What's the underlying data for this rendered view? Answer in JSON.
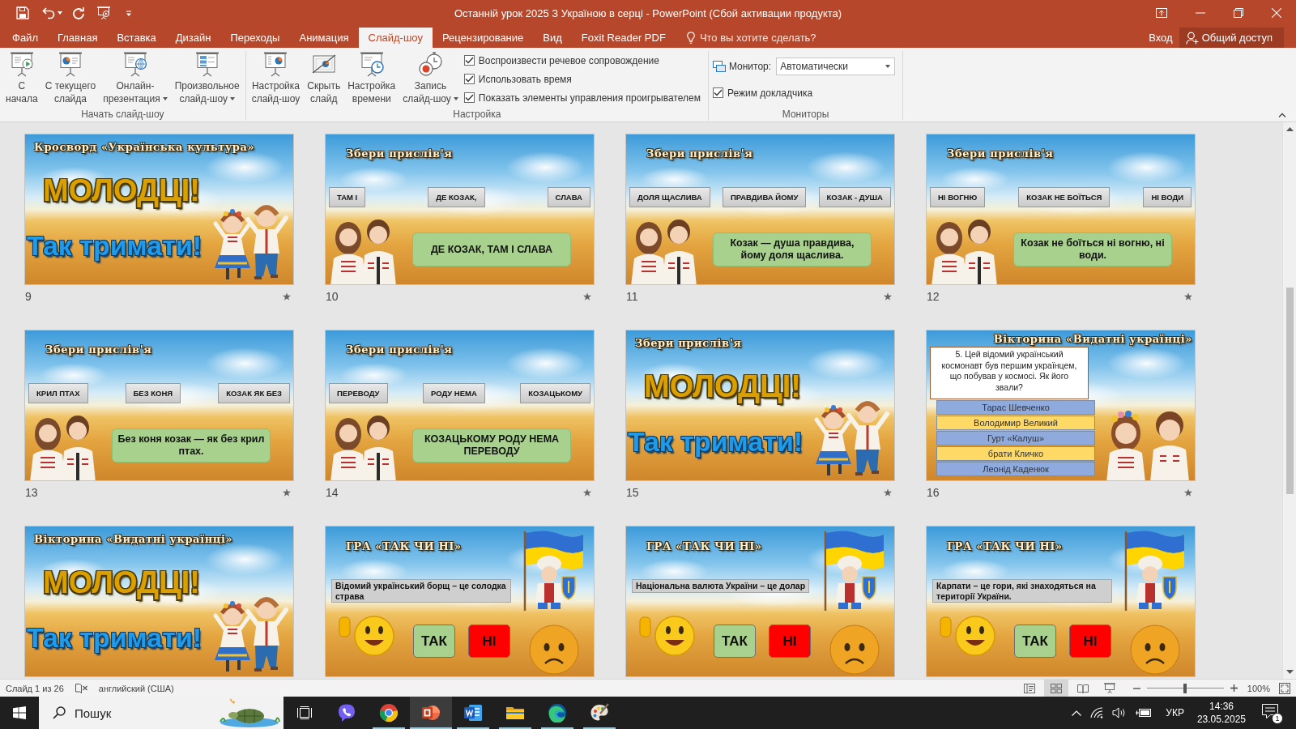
{
  "window": {
    "title": "Останній урок 2025 З Україною в серці - PowerPoint (Сбой активации продукта)"
  },
  "tabs": [
    {
      "label": "Файл",
      "selected": false
    },
    {
      "label": "Главная",
      "selected": false
    },
    {
      "label": "Вставка",
      "selected": false
    },
    {
      "label": "Дизайн",
      "selected": false
    },
    {
      "label": "Переходы",
      "selected": false
    },
    {
      "label": "Анимация",
      "selected": false
    },
    {
      "label": "Слайд-шоу",
      "selected": true
    },
    {
      "label": "Рецензирование",
      "selected": false
    },
    {
      "label": "Вид",
      "selected": false
    },
    {
      "label": "Foxit Reader PDF",
      "selected": false
    }
  ],
  "tell_me": {
    "placeholder": "Что вы хотите сделать?"
  },
  "account": {
    "sign_in": "Вход",
    "share": "Общий доступ"
  },
  "ribbon": {
    "groups": [
      {
        "label": "Начать слайд-шоу",
        "buttons": [
          {
            "kind": "from_start",
            "lines": [
              "С",
              "начала"
            ],
            "dropdown": false
          },
          {
            "kind": "from_current",
            "lines": [
              "С текущего",
              "слайда"
            ],
            "dropdown": false
          },
          {
            "kind": "online",
            "lines": [
              "Онлайн-",
              "презентация"
            ],
            "dropdown": true
          },
          {
            "kind": "custom",
            "lines": [
              "Произвольное",
              "слайд-шоу"
            ],
            "dropdown": true
          }
        ]
      },
      {
        "label": "Настройка",
        "buttons": [
          {
            "kind": "setup",
            "lines": [
              "Настройка",
              "слайд-шоу"
            ],
            "dropdown": false
          },
          {
            "kind": "hide",
            "lines": [
              "Скрыть",
              "слайд"
            ],
            "dropdown": false
          },
          {
            "kind": "timings",
            "lines": [
              "Настройка",
              "времени"
            ],
            "dropdown": false
          },
          {
            "kind": "record",
            "lines": [
              "Запись",
              "слайд-шоу"
            ],
            "dropdown": true
          }
        ],
        "checkboxes": [
          {
            "label": "Воспроизвести речевое сопровождение",
            "checked": true
          },
          {
            "label": "Использовать время",
            "checked": true
          },
          {
            "label": "Показать элементы управления проигрывателем",
            "checked": true
          }
        ]
      },
      {
        "label": "Мониторы",
        "monitor": {
          "label": "Монитор:",
          "value": "Автоматически"
        },
        "checkboxes": [
          {
            "label": "Режим докладчика",
            "checked": true
          }
        ]
      }
    ]
  },
  "slides": [
    {
      "number": "9",
      "animated": true,
      "kind": "celebration",
      "title": "Кросворд «Українська культура»",
      "cheer": "МОЛОДЦІ!",
      "motto": "Так тримати!"
    },
    {
      "number": "10",
      "animated": true,
      "kind": "proverb",
      "title": "Збери прислів'я",
      "tiles": [
        "ТАМ І",
        "ДЕ КОЗАК,",
        "СЛАВА"
      ],
      "answer": "ДЕ КОЗАК, ТАМ І СЛАВА"
    },
    {
      "number": "11",
      "animated": true,
      "kind": "proverb",
      "title": "Збери прислів'я",
      "tiles": [
        "ДОЛЯ ЩАСЛИВА",
        "ПРАВДИВА ЙОМУ",
        "КОЗАК - ДУША"
      ],
      "answer": "Козак — душа правдива, йому доля щаслива."
    },
    {
      "number": "12",
      "animated": true,
      "kind": "proverb",
      "title": "Збери прислів'я",
      "tiles": [
        "НІ ВОГНЮ",
        "КОЗАК НЕ БОЇТЬСЯ",
        "НІ ВОДИ"
      ],
      "answer": "Козак не боїться ні вогню, ні води."
    },
    {
      "number": "13",
      "animated": true,
      "kind": "proverb",
      "title": "Збери прислів'я",
      "tiles": [
        "КРИЛ ПТАХ",
        "БЕЗ КОНЯ",
        "КОЗАК ЯК БЕЗ"
      ],
      "answer": "Без коня козак — як без крил птах."
    },
    {
      "number": "14",
      "animated": true,
      "kind": "proverb",
      "title": "Збери прислів'я",
      "tiles": [
        "ПЕРЕВОДУ",
        "РОДУ НЕМА",
        "КОЗАЦЬКОМУ"
      ],
      "answer": "КОЗАЦЬКОМУ РОДУ НЕМА ПЕРЕВОДУ"
    },
    {
      "number": "15",
      "animated": true,
      "kind": "celebration",
      "title": "Збери прислів'я",
      "cheer": "МОЛОДЦІ!",
      "motto": "Так тримати!"
    },
    {
      "number": "16",
      "animated": true,
      "kind": "quiz",
      "title": "Вікторина «Видатні українці»",
      "question": "5. Цей відомий український космонавт був першим українцем, що побував у космосі. Як його звали?",
      "options": [
        {
          "label": "Тарас Шевченко",
          "color": "#8faadc"
        },
        {
          "label": "Володимир Великий",
          "color": "#ffd966"
        },
        {
          "label": "Гурт «Калуш»",
          "color": "#8faadc"
        },
        {
          "label": "брати Кличко",
          "color": "#ffd966"
        },
        {
          "label": "Леонід Каденюк",
          "color": "#8faadc"
        }
      ]
    },
    {
      "kind": "celebration",
      "title": "Вікторина «Видатні українці»",
      "cheer": "МОЛОДЦІ!",
      "motto": "Так тримати!"
    },
    {
      "kind": "yes_no",
      "title": "ГРА «ТАК ЧИ НІ»",
      "statement": "Відомий український борщ – це солодка страва",
      "yes": "ТАК",
      "no": "НІ"
    },
    {
      "kind": "yes_no",
      "title": "ГРА «ТАК ЧИ НІ»",
      "statement": "Національна валюта України – це долар",
      "yes": "ТАК",
      "no": "НІ"
    },
    {
      "kind": "yes_no",
      "title": "ГРА «ТАК ЧИ НІ»",
      "statement": "Карпати – це гори, які знаходяться на території України.",
      "yes": "ТАК",
      "no": "НІ"
    }
  ],
  "status_bar": {
    "slide_info": "Слайд 1 из 26",
    "language": "английский (США)",
    "views": [
      {
        "kind": "normal",
        "selected": false
      },
      {
        "kind": "sorter",
        "selected": true
      },
      {
        "kind": "reading",
        "selected": false
      },
      {
        "kind": "slideshow",
        "selected": false
      }
    ],
    "zoom": {
      "level": 0.5,
      "reading": "100%"
    }
  },
  "taskbar": {
    "search": {
      "placeholder": "Пошук"
    },
    "apps": [
      {
        "kind": "viber",
        "selected": false,
        "running": false
      },
      {
        "kind": "chrome",
        "selected": false,
        "running": true
      },
      {
        "kind": "powerpoint",
        "selected": true,
        "running": true
      },
      {
        "kind": "word",
        "selected": false,
        "running": true
      },
      {
        "kind": "explorer",
        "selected": false,
        "running": true
      },
      {
        "kind": "edge",
        "selected": false,
        "running": true
      },
      {
        "kind": "paint",
        "selected": false,
        "running": true
      }
    ],
    "tray": {
      "language": "УКР",
      "time": "14:36",
      "date": "23.05.2025",
      "notifications": "1"
    }
  }
}
